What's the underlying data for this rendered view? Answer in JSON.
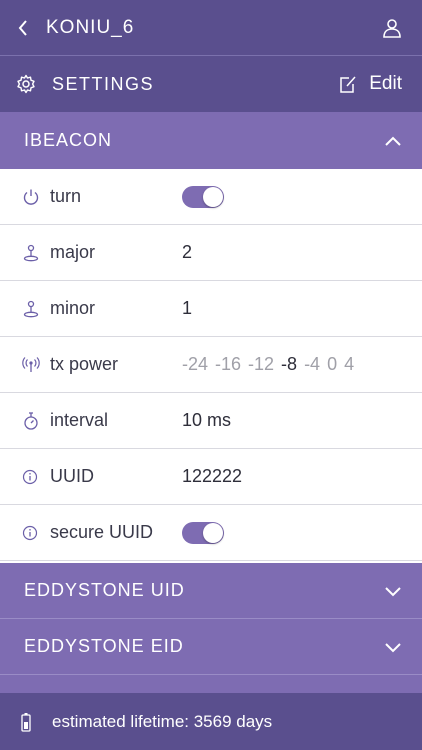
{
  "header": {
    "title": "KONIU_6",
    "back_icon": "chevron-left-icon",
    "user_icon": "user-icon"
  },
  "settings_bar": {
    "label": "SETTINGS",
    "edit_label": "Edit",
    "gear_icon": "gear-icon",
    "edit_icon": "edit-icon"
  },
  "ibeacon": {
    "title": "IBEACON",
    "expanded": true,
    "rows": {
      "turn": {
        "label": "turn",
        "icon": "power-icon",
        "toggle_on": true
      },
      "major": {
        "label": "major",
        "icon": "pin-icon",
        "value": "2"
      },
      "minor": {
        "label": "minor",
        "icon": "pin-icon",
        "value": "1"
      },
      "tx_power": {
        "label": "tx power",
        "icon": "antenna-icon",
        "options": [
          "-24",
          "-16",
          "-12",
          "-8",
          "-4",
          "0",
          "4"
        ],
        "selected": "-8"
      },
      "interval": {
        "label": "interval",
        "icon": "stopwatch-icon",
        "value": "10 ms"
      },
      "uuid": {
        "label": "UUID",
        "icon": "info-icon",
        "value": "122222"
      },
      "secure_uuid": {
        "label": "secure UUID",
        "icon": "info-icon",
        "toggle_on": true
      }
    }
  },
  "eddystone_uid": {
    "title": "EDDYSTONE UID",
    "expanded": false
  },
  "eddystone_eid": {
    "title": "EDDYSTONE EID",
    "expanded": false
  },
  "footer": {
    "text": "estimated lifetime: 3569 days",
    "icon": "battery-icon"
  },
  "colors": {
    "header_bg": "#5a4f8e",
    "section_bg": "#7e6cb2",
    "accent": "#7e6cb2",
    "icon": "#6b5fa8"
  }
}
